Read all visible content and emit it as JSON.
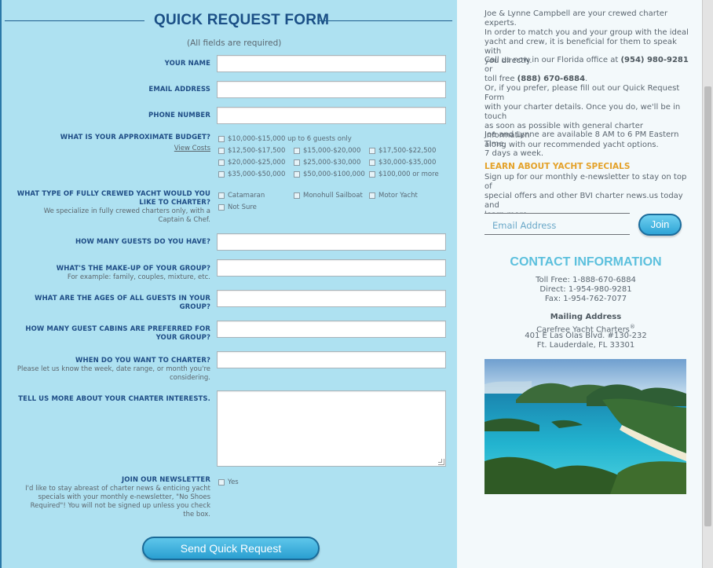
{
  "form": {
    "title": "QUICK REQUEST FORM",
    "required_note": "(All fields are required)",
    "fields": {
      "name_label": "YOUR NAME",
      "email_label": "EMAIL ADDRESS",
      "phone_label": "PHONE NUMBER",
      "budget_label": "WHAT IS YOUR APPROXIMATE BUDGET?",
      "view_costs": "View Costs",
      "yacht_type_label_1": "WHAT TYPE OF FULLY CREWED YACHT WOULD YOU",
      "yacht_type_label_2": "LIKE TO CHARTER?",
      "yacht_type_sub_1": "We specialize in fully crewed charters only, with a",
      "yacht_type_sub_2": "Captain & Chef.",
      "guests_label": "HOW MANY GUESTS DO YOU HAVE?",
      "makeup_label": "WHAT'S THE MAKE-UP OF YOUR GROUP?",
      "makeup_sub": "For example: family, couples, mixture, etc.",
      "ages_label_1": "WHAT ARE THE AGES OF ALL GUESTS IN YOUR",
      "ages_label_2": "GROUP?",
      "cabins_label_1": "HOW MANY GUEST CABINS ARE PREFERRED FOR",
      "cabins_label_2": "YOUR GROUP?",
      "when_label": "WHEN DO YOU WANT TO CHARTER?",
      "when_sub_1": "Please let us know the week, date range, or month you're",
      "when_sub_2": "considering.",
      "interests_label": "TELL US MORE ABOUT YOUR CHARTER INTERESTS.",
      "newsletter_label": "JOIN OUR NEWSLETTER",
      "newsletter_sub_1": "I'd like to stay abreast of charter news & enticing yacht",
      "newsletter_sub_2": "specials with your monthly e-newsletter, \"No Shoes",
      "newsletter_sub_3": "Required\"! You will not be signed up unless you check",
      "newsletter_sub_4": "the box.",
      "newsletter_option": "Yes"
    },
    "budget_options": [
      "$10,000-$15,000 up to 6 guests only",
      "$12,500-$17,500",
      "$15,000-$20,000",
      "$17,500-$22,500",
      "$20,000-$25,000",
      "$25,000-$30,000",
      "$30,000-$35,000",
      "$35,000-$50,000",
      "$50,000-$100,000",
      "$100,000 or more"
    ],
    "yacht_options": [
      "Catamaran",
      "Monohull Sailboat",
      "Motor Yacht",
      "Not Sure"
    ],
    "submit_label": "Send Quick Request"
  },
  "sidebar": {
    "intro_1": "Joe & Lynne Campbell are your crewed charter experts.",
    "intro_2": "In order to match you and your group with the ideal",
    "intro_3": "yacht and crew, it is beneficial for them to speak with",
    "intro_4": "you directly.",
    "call_1_pre": "Call us now in our Florida office at ",
    "call_phone_1": "(954) 980-9281",
    "call_1_post": " or",
    "call_2_pre": "toll free ",
    "call_phone_2": "(888) 670-6884",
    "call_2_post": ".",
    "or_1": "Or, if you prefer, please fill out our Quick Request Form",
    "or_2": "with your charter details. Once you do, we'll be in touch",
    "or_3": "as soon as possible with general charter information",
    "or_4": "along with our recommended yacht options.",
    "hours_1": "Joe and Lynne are available 8 AM to 6 PM Eastern Time,",
    "hours_2": "7 days a week.",
    "specials_heading": "LEARN ABOUT YACHT SPECIALS",
    "specials_1": "Sign up for our monthly e-newsletter to stay on top of",
    "specials_2": "special offers and other BVI charter news.us today and",
    "specials_3": "learn more.",
    "email_placeholder": "Email Address",
    "join_label": "Join",
    "contact_heading": "CONTACT INFORMATION",
    "toll_free": "Toll Free: 1-888-670-6884",
    "direct": "Direct: 1-954-980-9281",
    "fax": "Fax: 1-954-762-7077",
    "mailing_heading": "Mailing Address",
    "company": "Carefree Yacht Charters",
    "registered_mark": "®",
    "address_1": "401 E Las Olas Blvd. #130-232",
    "address_2": "Ft. Lauderdale, FL 33301"
  },
  "colors": {
    "form_bg": "#aee1f1",
    "label_blue": "#1f4d86",
    "accent_button": "#2a9fd1",
    "specials_orange": "#e4a22a",
    "contact_heading": "#5cc0dd"
  }
}
